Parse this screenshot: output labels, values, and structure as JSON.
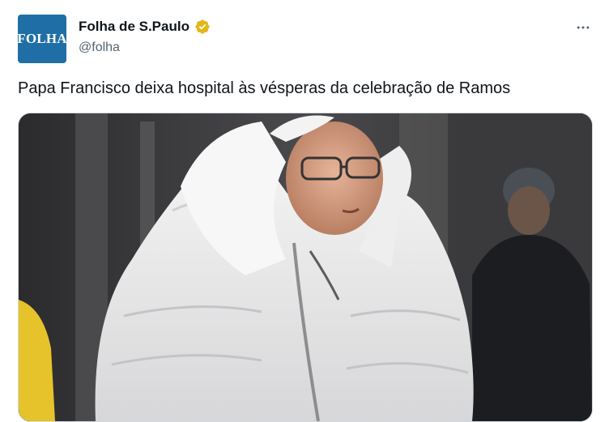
{
  "author": {
    "name": "Folha de S.Paulo",
    "handle": "@folha",
    "avatar_text": "FOLHA",
    "verified": true,
    "verified_color": "#e2b719",
    "avatar_color": "#1f6fa6"
  },
  "post": {
    "text": "Papa Francisco deixa hospital às vésperas da celebração de Ramos",
    "media": {
      "kind": "photo"
    }
  },
  "icons": {
    "more": "more-horizontal-icon",
    "verified": "verified-badge-icon"
  }
}
